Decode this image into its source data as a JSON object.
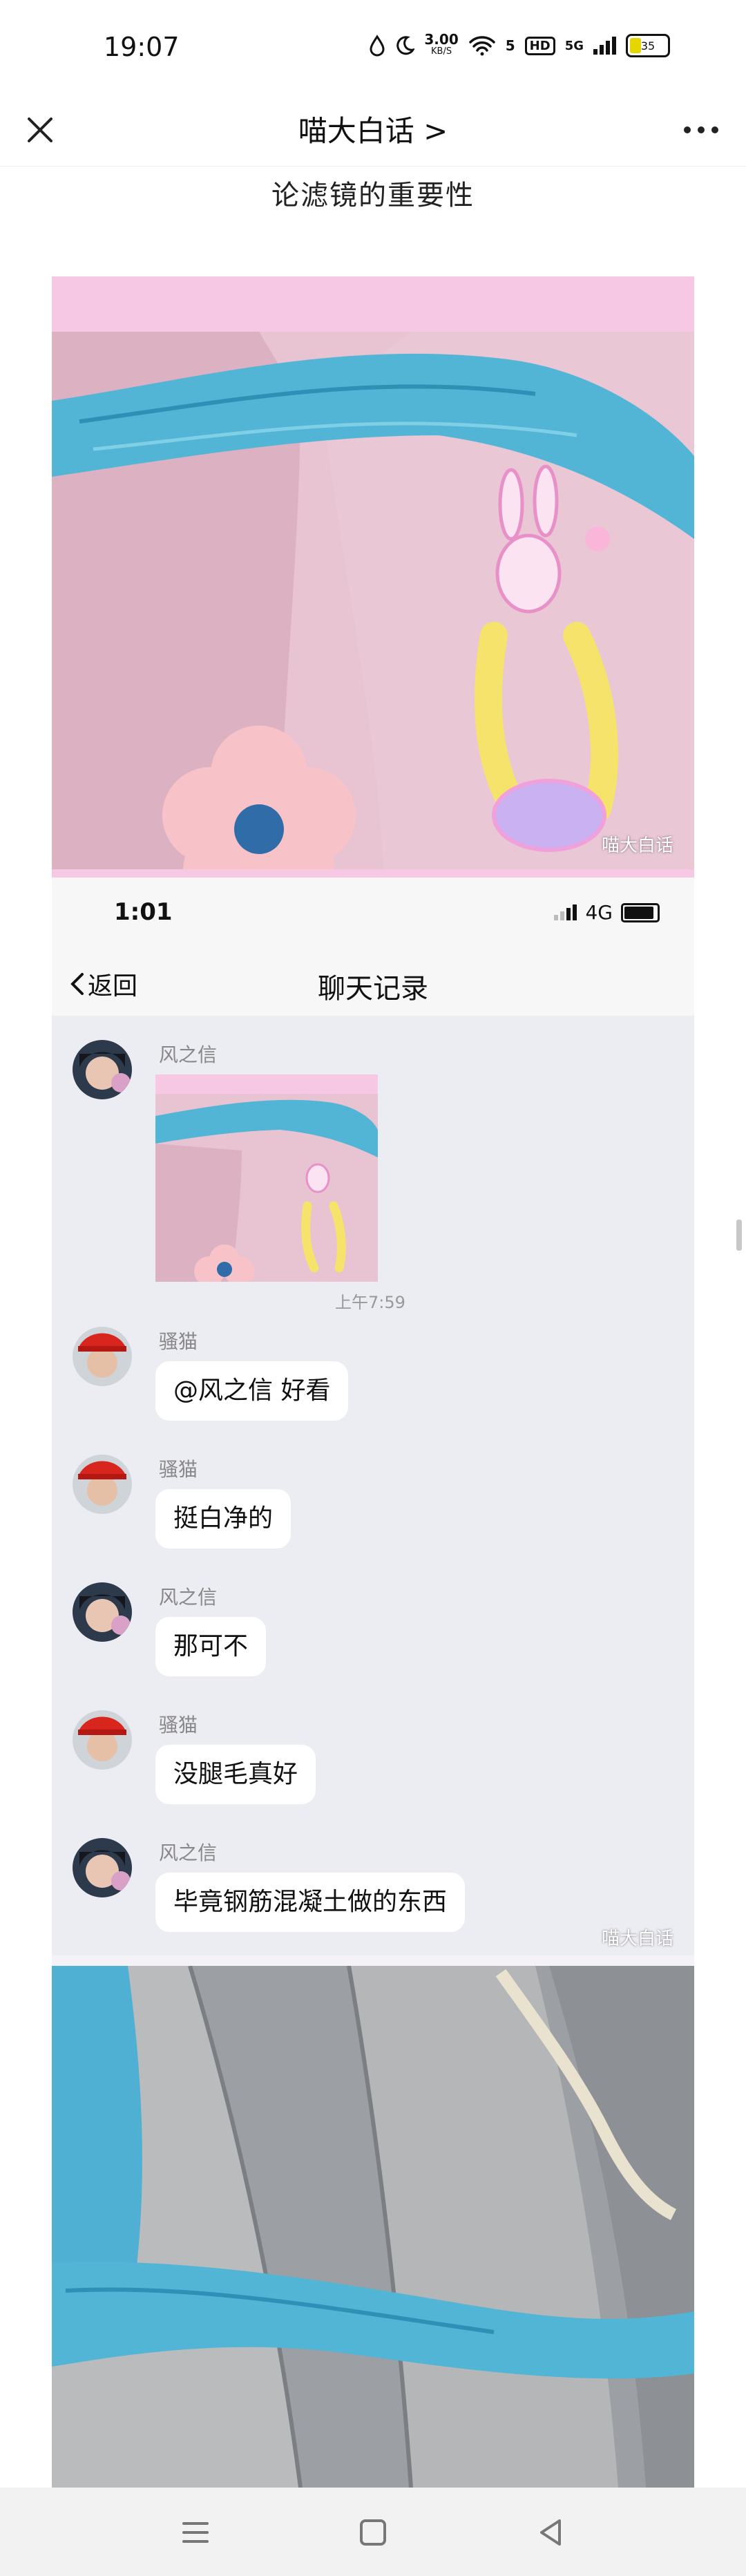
{
  "status_bar": {
    "time": "19:07",
    "net_speed_value": "3.00",
    "net_speed_unit": "KB/S",
    "network_5g_label": "5G",
    "signal_label": "5",
    "hd_label": "HD",
    "battery": "35"
  },
  "nav": {
    "title": "喵大白话 >",
    "close_icon": "close-icon",
    "more_icon": "more-dots-icon"
  },
  "article": {
    "heading": "论滤镜的重要性"
  },
  "meme": {
    "watermark": "喵大白话",
    "inner_status": {
      "time": "1:01",
      "network": "4G"
    },
    "chat_header": {
      "back_label": "返回",
      "title": "聊天记录"
    },
    "messages": [
      {
        "sender": "风之信",
        "type": "image",
        "time": "上午7:59"
      },
      {
        "sender": "骚猫",
        "text": "@风之信 好看"
      },
      {
        "sender": "骚猫",
        "text": "挺白净的"
      },
      {
        "sender": "风之信",
        "text": "那可不"
      },
      {
        "sender": "骚猫",
        "text": "没腿毛真好"
      },
      {
        "sender": "风之信",
        "text": "毕竟钢筋混凝土做的东西"
      }
    ]
  },
  "colors": {
    "pink_band": "#f7c8e4",
    "fabric_blue": "#4fb6d6",
    "chat_bg": "#ececf3",
    "pipe_gray": "#a7a9ab"
  }
}
